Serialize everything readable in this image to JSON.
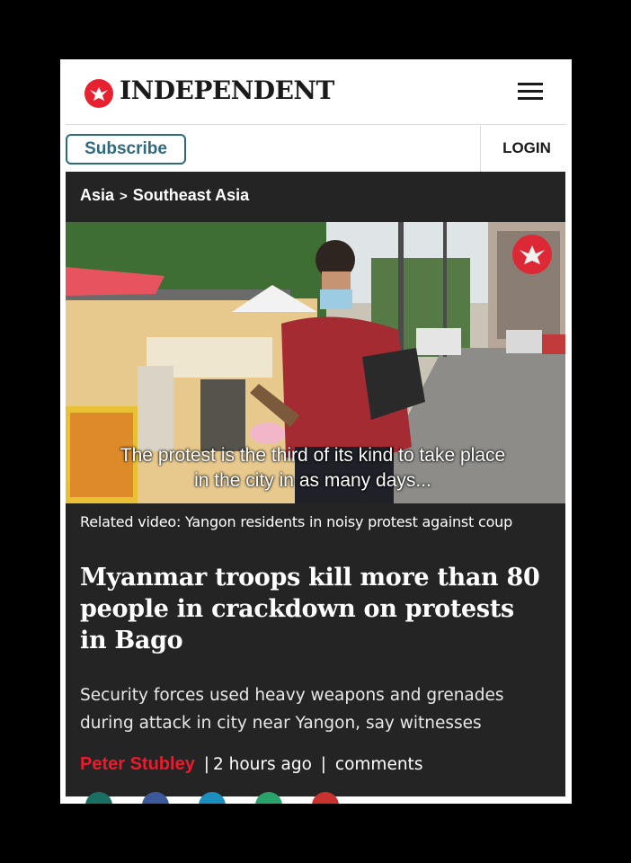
{
  "header": {
    "brand": "INDEPENDENT",
    "subscribe_label": "Subscribe",
    "login_label": "LOGIN"
  },
  "breadcrumb": {
    "items": [
      "Asia",
      "Southeast Asia"
    ],
    "separator": ">"
  },
  "video": {
    "caption_line1": "The protest is the third of its kind to take place",
    "caption_line2": "in the city in as many days..."
  },
  "related_video": "Related video: Yangon residents in noisy protest against coup",
  "article": {
    "headline": "Myanmar troops kill more than 80 people in crackdown on protests in Bago",
    "standfirst": "Security forces used heavy weapons and grenades during attack in city near Yangon, say witnesses",
    "author": "Peter Stubley",
    "time": "2 hours ago",
    "separator": "|",
    "comments": "comments"
  },
  "colors": {
    "brand_red": "#e7212f",
    "subscribe_teal": "#2d6a7f",
    "dark_panel": "#242424"
  }
}
